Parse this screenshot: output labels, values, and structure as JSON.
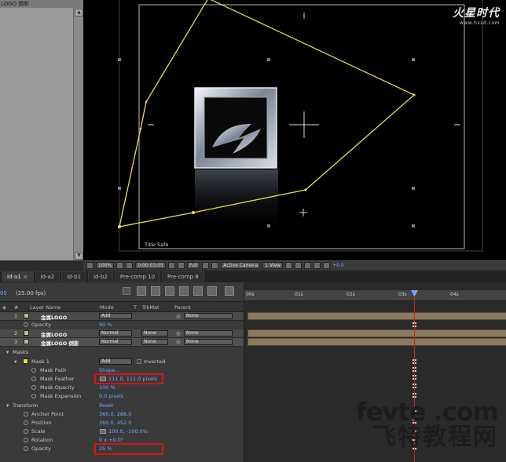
{
  "project": {
    "title": "LOGO 倒影"
  },
  "brand": {
    "name": "火星时代",
    "url": "www.hxsd.com"
  },
  "viewer": {
    "title_safe": "Title Safe"
  },
  "viewer_bar": {
    "zoom": "100%",
    "timecode": "0:00:03:05",
    "resolution": "Full",
    "camera": "Active Camera",
    "views": "1 View",
    "exposure": "+0.0"
  },
  "tabs": [
    {
      "label": "id-a1",
      "close": "×"
    },
    {
      "label": "id-a2"
    },
    {
      "label": "id-b1"
    },
    {
      "label": "id-b2"
    },
    {
      "label": "Pre-comp 10"
    },
    {
      "label": "Pre-comp 8"
    }
  ],
  "timeline": {
    "timecode_partial": "05",
    "fps": "(25.00 fps)",
    "ruler": [
      "00s",
      "01s",
      "02s",
      "03s",
      "04s"
    ]
  },
  "columns": {
    "num": "#",
    "layer_name": "Layer Name",
    "mode": "Mode",
    "t": "T",
    "trkmat": "TrkMat",
    "parent": "Parent"
  },
  "layers": [
    {
      "num": "1",
      "name": "金属LOGO",
      "mode": "Add",
      "parent": "None",
      "label_color": "#c9b48a"
    },
    {
      "num": "2",
      "name": "金属LOGO",
      "mode": "Normal",
      "trkmat": "None",
      "parent": "None",
      "label_color": "#c9b48a"
    },
    {
      "num": "3",
      "name": "金属LOGO 倒影",
      "mode": "Normal",
      "trkmat": "None",
      "parent": "None",
      "label_color": "#c9b48a"
    }
  ],
  "props": {
    "opacity_label": "Opacity",
    "opacity_val": "90 %",
    "masks_label": "Masks",
    "mask1_label": "Mask 1",
    "mask1_mode": "Add",
    "inverted_label": "Inverted",
    "mask_path_label": "Mask Path",
    "mask_path_val": "Shape...",
    "mask_feather_label": "Mask Feather",
    "mask_feather_val": "111.0, 111.0 pixels",
    "mask_opacity_label": "Mask Opacity",
    "mask_opacity_val": "100 %",
    "mask_expansion_label": "Mask Expansion",
    "mask_expansion_val": "0.0 pixels",
    "transform_label": "Transform",
    "transform_reset": "Reset",
    "anchor_label": "Anchor Point",
    "anchor_val": "360.0, 288.0",
    "position_label": "Position",
    "position_val": "360.0, 452.0",
    "scale_label": "Scale",
    "scale_val": "100.0, -100.0%",
    "rotation_label": "Rotation",
    "rotation_val": "0 x +0.0°",
    "opacity2_label": "Opacity",
    "opacity2_val": "25 %"
  },
  "watermark": {
    "en": "fevte .com",
    "cn": "飞特教程网"
  },
  "colors": {
    "mask": "#e8e040",
    "link": "#6ea8ff",
    "highlight": "#e01010",
    "cti": "#d42020"
  }
}
